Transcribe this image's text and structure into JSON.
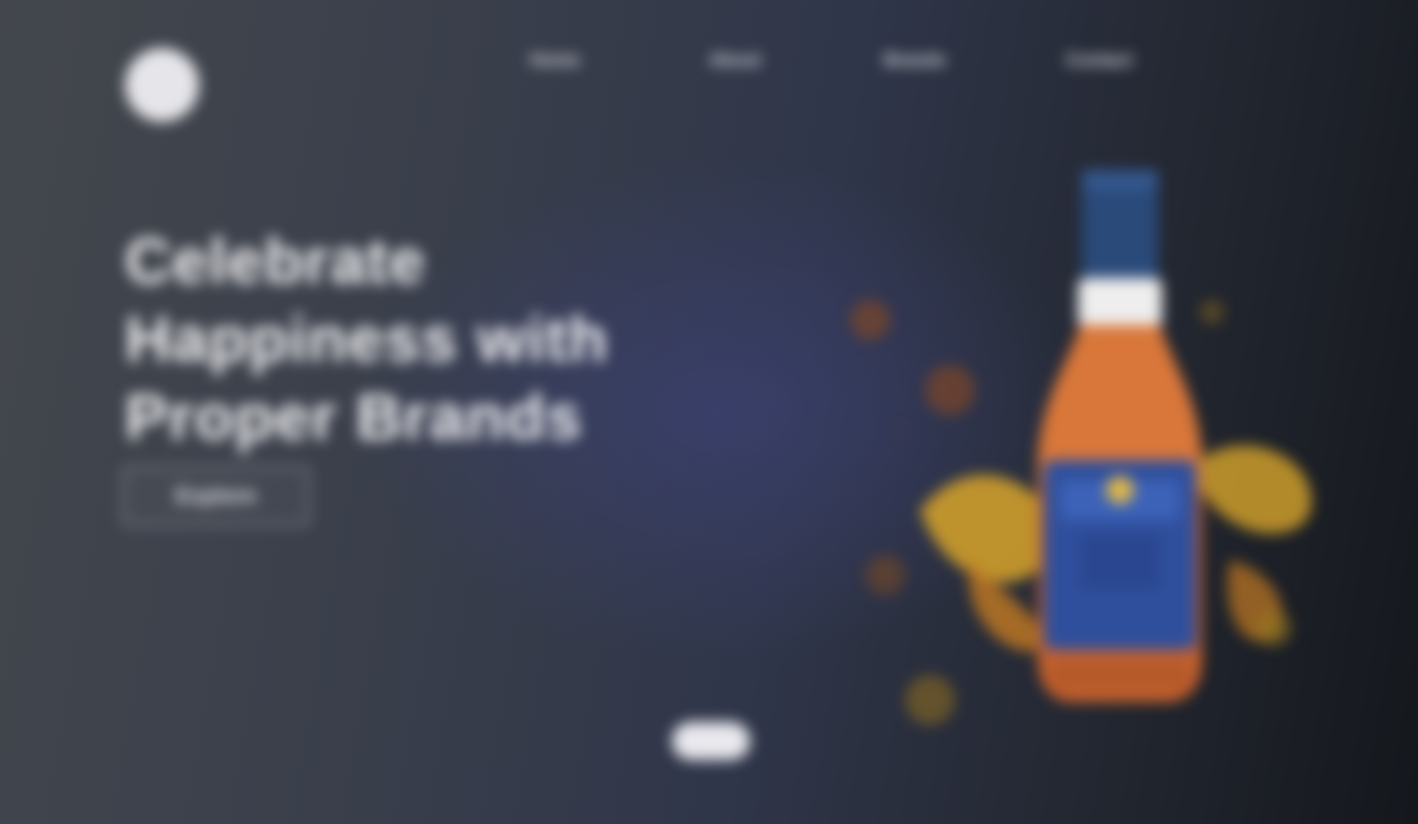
{
  "brand": {
    "logo_icon": "logo-circle-icon"
  },
  "nav": {
    "items": [
      {
        "label": "Home"
      },
      {
        "label": "About"
      },
      {
        "label": "Brands"
      },
      {
        "label": "Contact"
      }
    ]
  },
  "hero": {
    "title_line_1": "Celebrate",
    "title_line_2": "Happiness with",
    "title_line_3": "Proper Brands",
    "cta_label": "Explore"
  },
  "product": {
    "image_icon": "liquor-bottle-icon"
  },
  "scroll": {
    "indicator_icon": "scroll-pill-icon"
  },
  "colors": {
    "background_dark": "#14171c",
    "background_mid": "#30364a",
    "accent_glow": "#3a406e",
    "bottle_amber": "#c8622e",
    "bottle_label_blue": "#2f4f9c",
    "splash_gold": "#d8a52a"
  }
}
